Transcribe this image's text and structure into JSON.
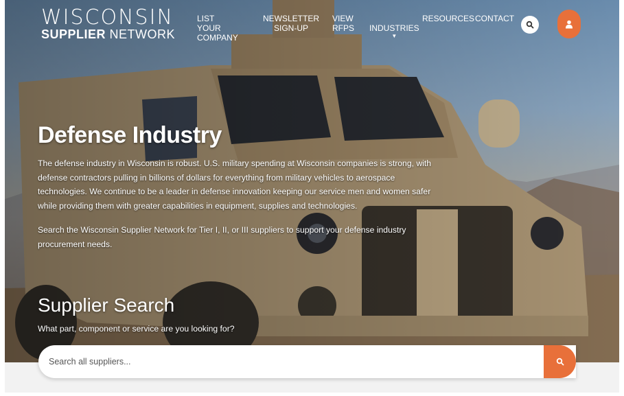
{
  "logo": {
    "line1": "WISCONSIN",
    "line2_bold": "SUPPLIER",
    "line2_light": "NETWORK"
  },
  "nav": {
    "items": [
      {
        "label": "LIST YOUR\nCOMPANY"
      },
      {
        "label": "NEWSLETTER\nSIGN-UP"
      },
      {
        "label": "VIEW\nRFPS"
      },
      {
        "label": "INDUSTRIES"
      },
      {
        "label": "RESOURCES"
      },
      {
        "label": "CONTACT"
      }
    ]
  },
  "icons": {
    "search": "search-icon",
    "user": "user-icon",
    "dropdown": "caret-down-icon"
  },
  "colors": {
    "accent": "#e8703a",
    "text_on_hero": "#ffffff"
  },
  "hero": {
    "title": "Defense Industry",
    "paragraph1": "The defense industry in Wisconsin is robust. U.S. military spending at Wisconsin companies is strong, with defense contractors pulling in billions of dollars for everything from military vehicles to aerospace technologies. We continue to be a leader in defense innovation keeping our service men and women safer while providing them with greater capabilities in equipment, supplies and technologies.",
    "paragraph2": "Search the Wisconsin Supplier Network for Tier I, II, or III suppliers to support your defense industry procurement needs."
  },
  "supplier_search": {
    "title": "Supplier Search",
    "subtitle": "What part, component or service are you looking for?",
    "placeholder": "Search all suppliers...",
    "value": ""
  }
}
